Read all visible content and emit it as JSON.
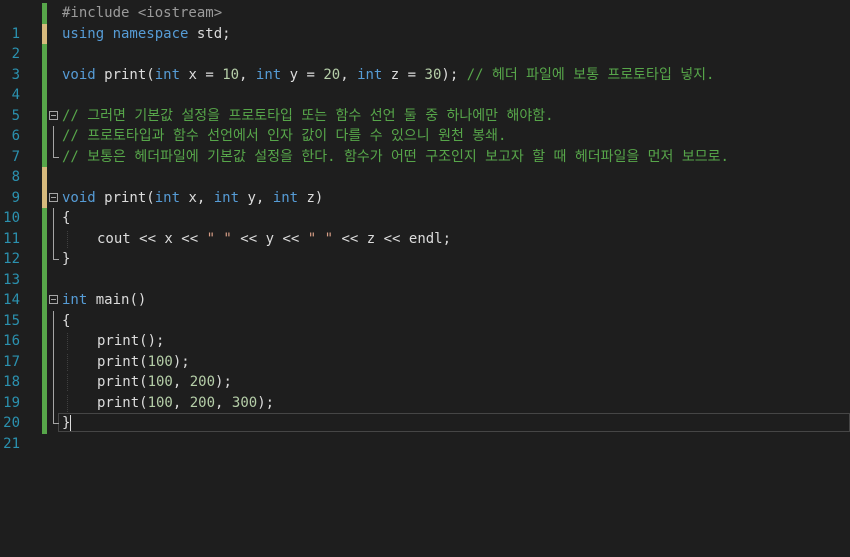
{
  "editor": {
    "line_numbers": [
      "1",
      "2",
      "3",
      "4",
      "5",
      "6",
      "7",
      "8",
      "9",
      "10",
      "11",
      "12",
      "13",
      "14",
      "15",
      "16",
      "17",
      "18",
      "19",
      "20",
      "21"
    ],
    "lines": [
      {
        "pp": "#include <iostream>"
      },
      {
        "kw": "using namespace",
        "txt": " std;"
      },
      {},
      {
        "kw1": "void",
        "t1": " print(",
        "kw2": "int",
        "t2": " x = ",
        "n1": "10",
        "t3": ", ",
        "kw3": "int",
        "t4": " y = ",
        "n2": "20",
        "t5": ", ",
        "kw4": "int",
        "t6": " z = ",
        "n3": "30",
        "t7": "); ",
        "cm": "// 헤더 파일에 보통 프로토타입 넣지."
      },
      {},
      {
        "cm": "// 그러면 기본값 설정을 프로토타입 또는 함수 선언 둘 중 하나에만 해야함."
      },
      {
        "cm": "// 프로토타입과 함수 선언에서 인자 값이 다를 수 있으니 원천 봉쇄."
      },
      {
        "cm": "// 보통은 헤더파일에 기본값 설정을 한다. 함수가 어떤 구조인지 보고자 할 때 헤더파일을 먼저 보므로."
      },
      {},
      {
        "kw1": "void",
        "t1": " print(",
        "kw2": "int",
        "t2": " x, ",
        "kw3": "int",
        "t3": " y, ",
        "kw4": "int",
        "t4": " z)"
      },
      {
        "txt": "{"
      },
      {
        "t1": "cout << x << ",
        "s1": "\" \"",
        "t2": " << y << ",
        "s2": "\" \"",
        "t3": " << z << endl;"
      },
      {
        "txt": "}"
      },
      {},
      {
        "kw": "int",
        "txt": " main()"
      },
      {
        "txt": "{"
      },
      {
        "txt": "print();"
      },
      {
        "t1": "print(",
        "n1": "100",
        "t2": ");"
      },
      {
        "t1": "print(",
        "n1": "100",
        "t2": ", ",
        "n2": "200",
        "t3": ");"
      },
      {
        "t1": "print(",
        "n1": "100",
        "t2": ", ",
        "n2": "200",
        "t3": ", ",
        "n3": "300",
        "t4": ");"
      },
      {
        "txt": "}"
      }
    ]
  },
  "colors": {
    "background": "#1e1e1e",
    "keyword": "#569cd6",
    "comment": "#57a64a",
    "number": "#b5cea8",
    "string": "#d69d85",
    "preprocessor": "#9b9b9b",
    "line_number": "#2b91af",
    "change_saved": "#57a64a",
    "change_unsaved": "#d7ba7d"
  }
}
